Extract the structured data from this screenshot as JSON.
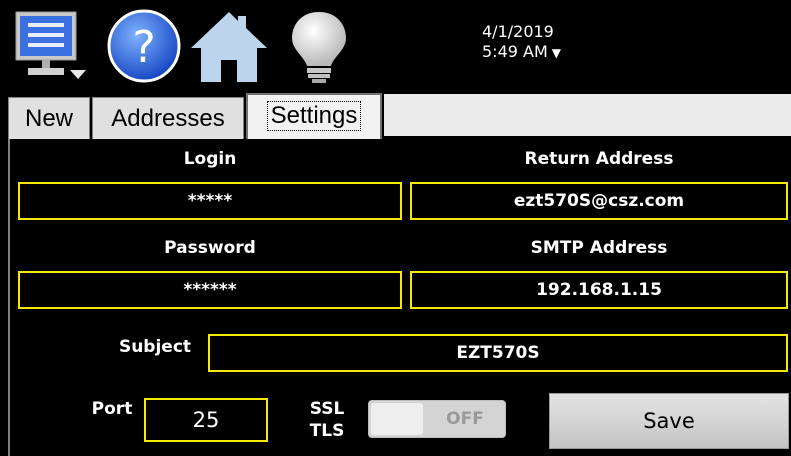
{
  "header": {
    "date": "4/1/2019",
    "time": "5:49 AM",
    "icons": [
      "monitor-menu-icon",
      "help-icon",
      "home-icon",
      "light-bulb-icon",
      "chevron-down-icon"
    ]
  },
  "tabs": [
    {
      "label": "New",
      "active": false
    },
    {
      "label": "Addresses",
      "active": false
    },
    {
      "label": "Settings",
      "active": true
    }
  ],
  "form": {
    "login_label": "Login",
    "login_value": "*****",
    "return_address_label": "Return Address",
    "return_address_value": "ezt570S@csz.com",
    "password_label": "Password",
    "password_value": "******",
    "smtp_label": "SMTP Address",
    "smtp_value": "192.168.1.15",
    "subject_label": "Subject",
    "subject_value": "EZT570S",
    "port_label": "Port",
    "port_value": "25",
    "ssl_label": "SSL",
    "tls_label": "TLS",
    "toggle_state": "OFF",
    "save_label": "Save"
  },
  "colors": {
    "field_border": "#f5e70a",
    "background": "#000000",
    "tab_bg": "#e0e0e0"
  }
}
